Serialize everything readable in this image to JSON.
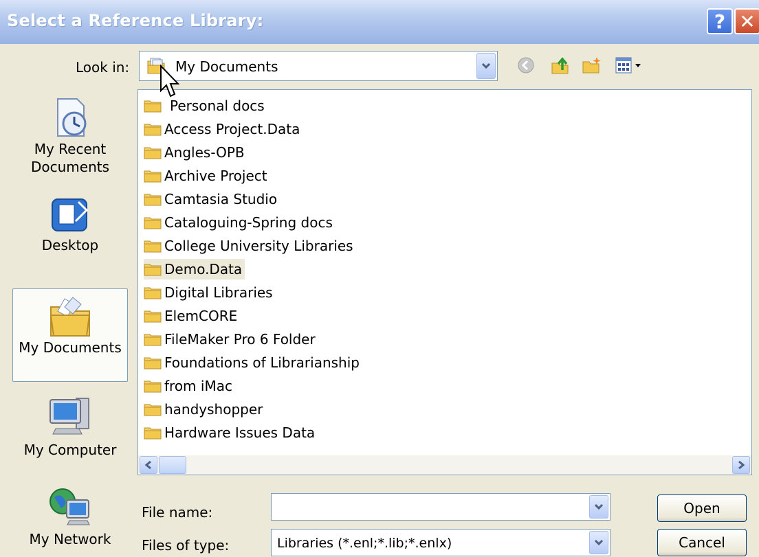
{
  "window": {
    "title": "Select a Reference Library:",
    "help_glyph": "?",
    "close_glyph": "✕"
  },
  "lookin": {
    "label": "Look in:",
    "value": "My Documents",
    "icon": "my-documents-icon"
  },
  "toolbar": {
    "icons": [
      "back-icon",
      "up-one-level-icon",
      "new-folder-icon",
      "views-menu-icon"
    ]
  },
  "places": [
    {
      "label_line1": "My Recent",
      "label_line2": "Documents",
      "icon": "recent-documents-icon"
    },
    {
      "label_line1": "Desktop",
      "label_line2": "",
      "icon": "desktop-icon"
    },
    {
      "label_line1": "My Documents",
      "label_line2": "",
      "icon": "my-documents-folder-icon",
      "selected": true
    },
    {
      "label_line1": "My Computer",
      "label_line2": "",
      "icon": "my-computer-icon"
    },
    {
      "label_line1": "My Network",
      "label_line2": "",
      "icon": "my-network-icon"
    }
  ],
  "files": [
    "Personal docs",
    "Access Project.Data",
    "Angles-OPB",
    "Archive Project",
    "Camtasia Studio",
    "Cataloguing-Spring docs",
    "College University Libraries",
    "Demo.Data",
    "Digital Libraries",
    "ElemCORE",
    "FileMaker Pro 6 Folder",
    "Foundations of Librarianship",
    "from iMac",
    "handyshopper",
    "Hardware Issues Data"
  ],
  "form": {
    "filename_label": "File name:",
    "filename_value": "",
    "filetype_label": "Files of type:",
    "filetype_value": "Libraries (*.enl;*.lib;*.enlx)"
  },
  "buttons": {
    "open": "Open",
    "cancel": "Cancel"
  },
  "colors": {
    "titlebar": "#a9c0ea",
    "dialog_bg": "#ece9d8",
    "folder": "#f2c94c"
  }
}
